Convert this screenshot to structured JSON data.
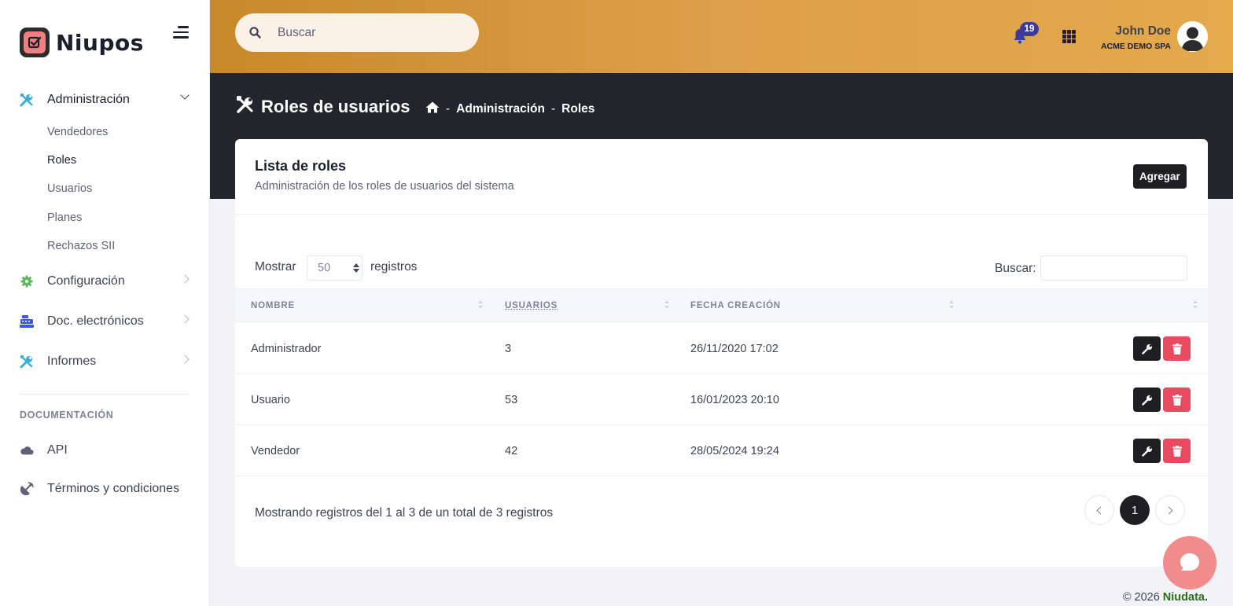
{
  "brand": {
    "name": "Niupos"
  },
  "sidebar": {
    "items": [
      {
        "label": "Administración",
        "icon": "tools-icon"
      },
      {
        "label": "Configuración",
        "icon": "gear-icon"
      },
      {
        "label": "Doc. electrónicos",
        "icon": "cash-register-icon"
      },
      {
        "label": "Informes",
        "icon": "tools-icon"
      }
    ],
    "subitems": [
      "Vendedores",
      "Roles",
      "Usuarios",
      "Planes",
      "Rechazos SII"
    ],
    "section_title": "DOCUMENTACIÓN",
    "doc_items": [
      {
        "label": "API",
        "icon": "cloud-icon"
      },
      {
        "label": "Términos y condiciones",
        "icon": "satellite-icon"
      }
    ]
  },
  "header": {
    "search_placeholder": "Buscar",
    "notifications_count": "19",
    "user_name": "John Doe",
    "user_company": "ACME DEMO SPA"
  },
  "subheader": {
    "title": "Roles de usuarios",
    "breadcrumbs": [
      "Administración",
      "Roles"
    ]
  },
  "card": {
    "title": "Lista de roles",
    "subtitle": "Administración de los roles de usuarios del sistema",
    "add_label": "Agregar",
    "show_label": "Mostrar",
    "page_length": "50",
    "records_label": "registros",
    "search_label": "Buscar:",
    "columns": [
      "NOMBRE",
      "USUARIOS",
      "FECHA CREACIÓN"
    ],
    "rows": [
      {
        "name": "Administrador",
        "users": "3",
        "created": "26/11/2020 17:02"
      },
      {
        "name": "Usuario",
        "users": "53",
        "created": "16/01/2023 20:10"
      },
      {
        "name": "Vendedor",
        "users": "42",
        "created": "28/05/2024 19:24"
      }
    ],
    "info": "Mostrando registros del 1 al 3 de un total de 3 registros",
    "current_page": "1"
  },
  "footer": {
    "copyright": "© 2026",
    "company": "Niudata."
  },
  "colors": {
    "accent": "#dda04a",
    "dark": "#22252b",
    "danger": "#e84a5f",
    "brand": "#f08080"
  }
}
